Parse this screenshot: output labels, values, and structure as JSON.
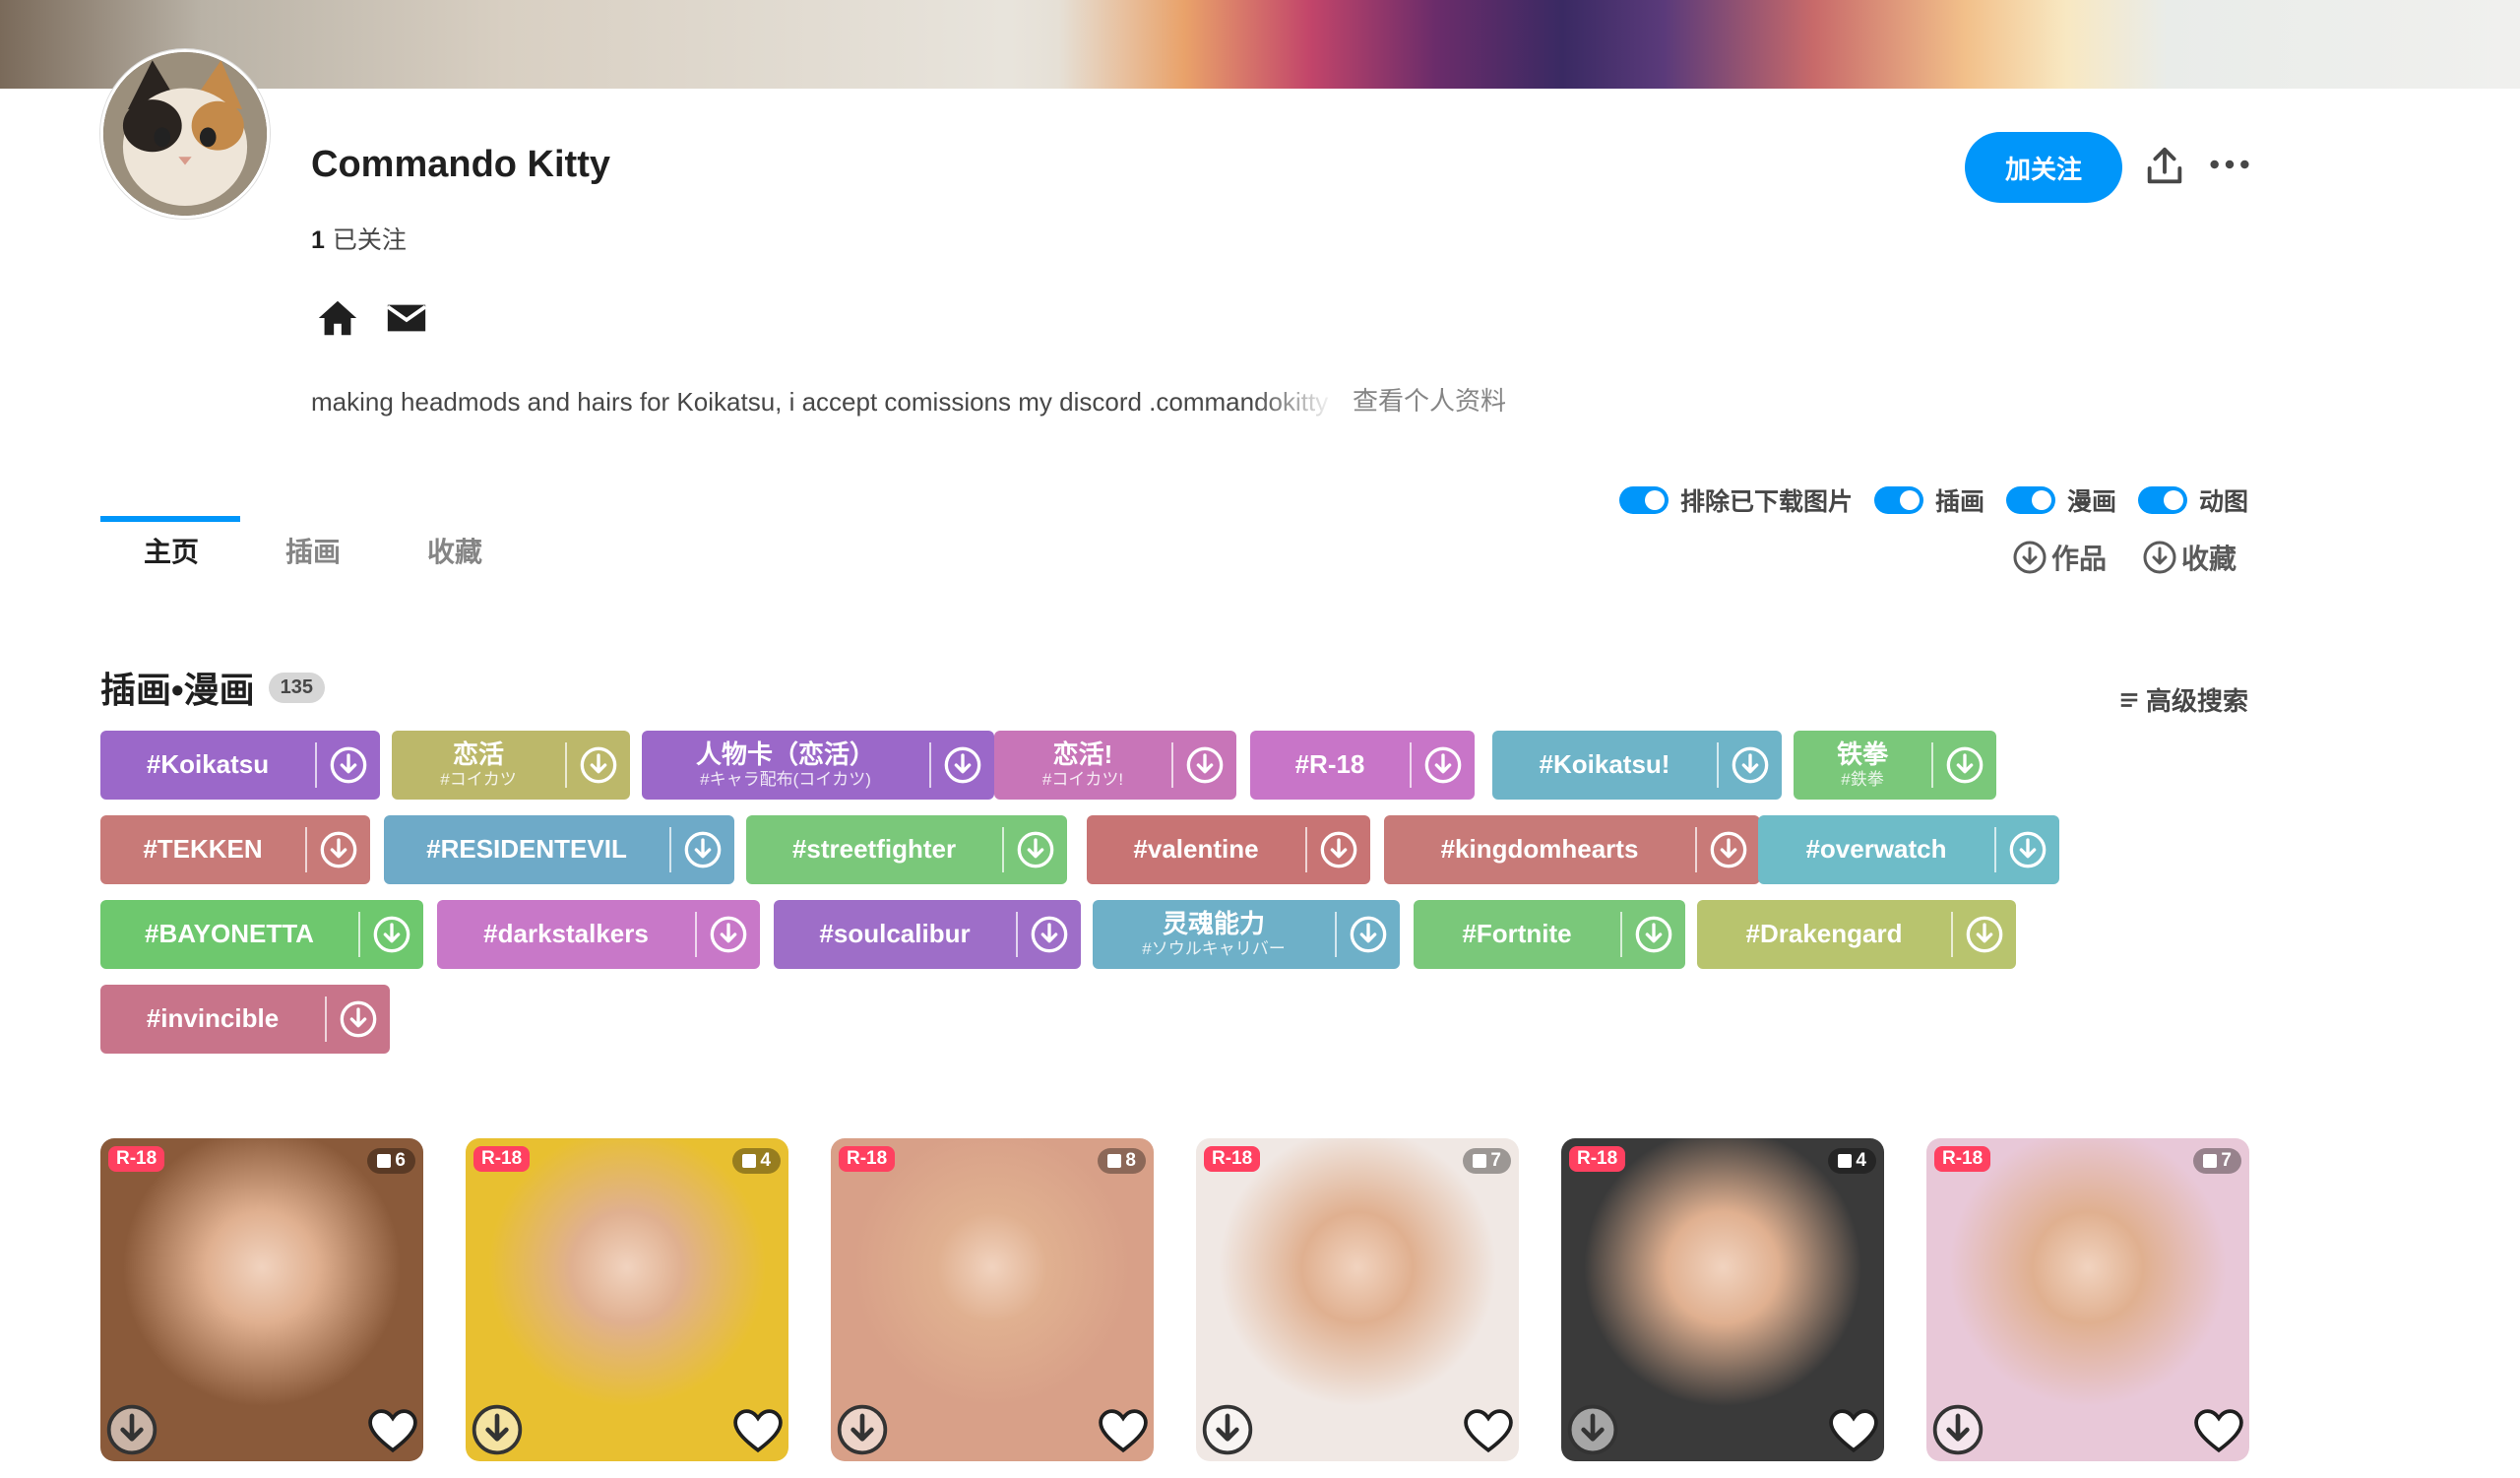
{
  "profile": {
    "name": "Commando Kitty",
    "following_count": "1",
    "following_label": "已关注",
    "bio": "making headmods and hairs for Koikatsu, i accept comissions my discord .commandokitty",
    "view_profile": "查看个人资料",
    "follow_button": "加关注"
  },
  "filters": [
    {
      "label": "排除已下载图片",
      "on": true
    },
    {
      "label": "插画",
      "on": true
    },
    {
      "label": "漫画",
      "on": true
    },
    {
      "label": "动图",
      "on": true
    }
  ],
  "tabs": [
    {
      "label": "主页",
      "active": true
    },
    {
      "label": "插画",
      "active": false
    },
    {
      "label": "收藏",
      "active": false
    }
  ],
  "download_links": [
    {
      "label": "作品"
    },
    {
      "label": "收藏"
    }
  ],
  "section": {
    "title": "插画•漫画",
    "count": "135",
    "advanced_search": "高级搜索"
  },
  "tags": [
    {
      "name": "#Koikatsu",
      "sub": "",
      "color": "#9b68c9"
    },
    {
      "name": "恋活",
      "sub": "#コイカツ",
      "color": "#bcb86a"
    },
    {
      "name": "人物卡（恋活）",
      "sub": "#キャラ配布(コイカツ)",
      "color": "#9b68c9"
    },
    {
      "name": "恋活!",
      "sub": "#コイカツ!",
      "color": "#c875b8"
    },
    {
      "name": "#R-18",
      "sub": "",
      "color": "#c875c8"
    },
    {
      "name": "#Koikatsu!",
      "sub": "",
      "color": "#6eb4c8"
    },
    {
      "name": "铁拳",
      "sub": "#鉄拳",
      "color": "#7ac87a"
    },
    {
      "name": "#TEKKEN",
      "sub": "",
      "color": "#c87a78"
    },
    {
      "name": "#RESIDENTEVIL",
      "sub": "",
      "color": "#6eaac8"
    },
    {
      "name": "#streetfighter",
      "sub": "",
      "color": "#7ac87a"
    },
    {
      "name": "#valentine",
      "sub": "",
      "color": "#c87474"
    },
    {
      "name": "#kingdomhearts",
      "sub": "",
      "color": "#c87a78"
    },
    {
      "name": "#overwatch",
      "sub": "",
      "color": "#6ebcc8"
    },
    {
      "name": "#BAYONETTA",
      "sub": "",
      "color": "#6ec86e"
    },
    {
      "name": "#darkstalkers",
      "sub": "",
      "color": "#c878c8"
    },
    {
      "name": "#soulcalibur",
      "sub": "",
      "color": "#9e6ec8"
    },
    {
      "name": "灵魂能力",
      "sub": "#ソウルキャリバー",
      "color": "#6eb0c8"
    },
    {
      "name": "#Fortnite",
      "sub": "",
      "color": "#7ac87a"
    },
    {
      "name": "#Drakengard",
      "sub": "",
      "color": "#b8c46e"
    },
    {
      "name": "#invincible",
      "sub": "",
      "color": "#c8748a"
    }
  ],
  "artworks": [
    {
      "badge": "R-18",
      "pages": "6",
      "bg": "#8a5a3a"
    },
    {
      "badge": "R-18",
      "pages": "4",
      "bg": "#e8c030"
    },
    {
      "badge": "R-18",
      "pages": "8",
      "bg": "#d8a088"
    },
    {
      "badge": "R-18",
      "pages": "7",
      "bg": "#f0e8e4"
    },
    {
      "badge": "R-18",
      "pages": "4",
      "bg": "#3a3a3a"
    },
    {
      "badge": "R-18",
      "pages": "7",
      "bg": "#e8c8d8"
    }
  ]
}
